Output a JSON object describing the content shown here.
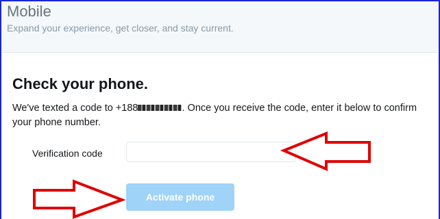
{
  "header": {
    "title": "Mobile",
    "subtitle": "Expand your experience, get closer, and stay current."
  },
  "verify": {
    "title": "Check your phone.",
    "message_before": "We've texted a code to +188",
    "message_after": ". Once you receive the code, enter it below to confirm your phone number.",
    "field_label": "Verification code",
    "field_value": "",
    "field_placeholder": "",
    "button_label": "Activate phone"
  },
  "colors": {
    "frame_border": "#1a25d6",
    "annotation_arrow": "#e00000",
    "button_bg": "#9fd3f7"
  },
  "annotations": [
    "right-arrow",
    "left-arrow"
  ]
}
